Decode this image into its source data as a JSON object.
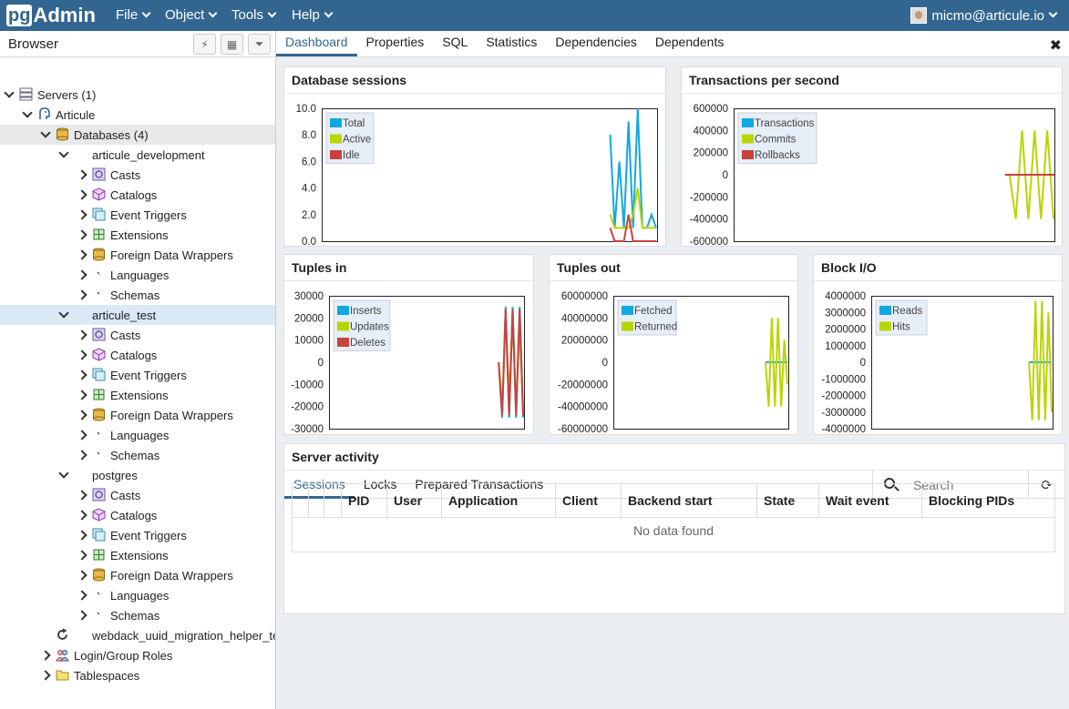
{
  "app": {
    "logo_pg": "pg",
    "logo_rest": "Admin"
  },
  "menu": {
    "file": "File",
    "object": "Object",
    "tools": "Tools",
    "help": "Help"
  },
  "user": {
    "email": "micmo@articule.io"
  },
  "browser": {
    "title": "Browser"
  },
  "tree": [
    {
      "label": "Servers (1)",
      "icon": "servers-icon"
    },
    {
      "label": "Articule",
      "icon": "elephant-icon"
    },
    {
      "label": "Databases (4)",
      "icon": "databases-icon"
    },
    {
      "label": "articule_development",
      "icon": "database-icon"
    },
    {
      "label": "Casts",
      "icon": "casts-icon"
    },
    {
      "label": "Catalogs",
      "icon": "catalogs-icon"
    },
    {
      "label": "Event Triggers",
      "icon": "event-triggers-icon"
    },
    {
      "label": "Extensions",
      "icon": "extensions-icon"
    },
    {
      "label": "Foreign Data Wrappers",
      "icon": "fdw-icon"
    },
    {
      "label": "Languages",
      "icon": "languages-icon"
    },
    {
      "label": "Schemas",
      "icon": "schemas-icon"
    },
    {
      "label": "articule_test",
      "icon": "database-icon"
    },
    {
      "label": "Casts",
      "icon": "casts-icon"
    },
    {
      "label": "Catalogs",
      "icon": "catalogs-icon"
    },
    {
      "label": "Event Triggers",
      "icon": "event-triggers-icon"
    },
    {
      "label": "Extensions",
      "icon": "extensions-icon"
    },
    {
      "label": "Foreign Data Wrappers",
      "icon": "fdw-icon"
    },
    {
      "label": "Languages",
      "icon": "languages-icon"
    },
    {
      "label": "Schemas",
      "icon": "schemas-icon"
    },
    {
      "label": "postgres",
      "icon": "database-icon"
    },
    {
      "label": "Casts",
      "icon": "casts-icon"
    },
    {
      "label": "Catalogs",
      "icon": "catalogs-icon"
    },
    {
      "label": "Event Triggers",
      "icon": "event-triggers-icon"
    },
    {
      "label": "Extensions",
      "icon": "extensions-icon"
    },
    {
      "label": "Foreign Data Wrappers",
      "icon": "fdw-icon"
    },
    {
      "label": "Languages",
      "icon": "languages-icon"
    },
    {
      "label": "Schemas",
      "icon": "schemas-icon"
    },
    {
      "label": "webdack_uuid_migration_helper_test",
      "icon": "spinner-icon"
    },
    {
      "label": "Login/Group Roles",
      "icon": "roles-icon"
    },
    {
      "label": "Tablespaces",
      "icon": "tablespaces-icon"
    }
  ],
  "tabs": [
    "Dashboard",
    "Properties",
    "SQL",
    "Statistics",
    "Dependencies",
    "Dependents"
  ],
  "colors": {
    "header": "#326690",
    "blue": "#12a8e0",
    "green": "#b9d500",
    "red": "#c8423f"
  },
  "panels": {
    "sessions_title": "Database sessions",
    "tps_title": "Transactions per second",
    "tuples_in_title": "Tuples in",
    "tuples_out_title": "Tuples out",
    "blockio_title": "Block I/O",
    "activity_title": "Server activity"
  },
  "chart_data": [
    {
      "type": "line",
      "title": "Database sessions",
      "ylim": [
        0,
        10
      ],
      "y_ticks": [
        "10.0",
        "8.0",
        "6.0",
        "4.0",
        "2.0",
        "0.0"
      ],
      "legend": "top-left",
      "series": [
        {
          "name": "Total",
          "color": "#12a8e0",
          "values": [
            8,
            1,
            6,
            1,
            9,
            1,
            10,
            1,
            1,
            2,
            1
          ]
        },
        {
          "name": "Active",
          "color": "#b9d500",
          "values": [
            2,
            1,
            1,
            1,
            1,
            2,
            4,
            1,
            1,
            1,
            1
          ]
        },
        {
          "name": "Idle",
          "color": "#c8423f",
          "values": [
            1,
            0,
            0,
            0,
            2,
            0,
            0,
            0,
            0,
            0,
            0
          ]
        }
      ]
    },
    {
      "type": "line",
      "title": "Transactions per second",
      "ylim": [
        -600000,
        600000
      ],
      "y_ticks": [
        "600000",
        "400000",
        "200000",
        "0",
        "-200000",
        "-400000",
        "-600000"
      ],
      "legend": "top-left",
      "series": [
        {
          "name": "Transactions",
          "color": "#12a8e0",
          "values": [
            0,
            0,
            0,
            0,
            0,
            0,
            0,
            0
          ]
        },
        {
          "name": "Commits",
          "color": "#b9d500",
          "values": [
            0,
            -400000,
            400000,
            -400000,
            400000,
            -400000,
            400000,
            -400000
          ]
        },
        {
          "name": "Rollbacks",
          "color": "#c8423f",
          "values": [
            0,
            0,
            0,
            0,
            0,
            0,
            0,
            0
          ]
        }
      ]
    },
    {
      "type": "line",
      "title": "Tuples in",
      "ylim": [
        -30000,
        30000
      ],
      "y_ticks": [
        "30000",
        "20000",
        "10000",
        "0",
        "-10000",
        "-20000",
        "-30000"
      ],
      "legend": "top-left",
      "series": [
        {
          "name": "Inserts",
          "color": "#12a8e0",
          "values": [
            0,
            -25000,
            25000,
            -25000,
            25000,
            -25000,
            25000,
            -25000
          ]
        },
        {
          "name": "Updates",
          "color": "#b9d500",
          "values": [
            0,
            -20000,
            20000,
            -15000,
            20000,
            -20000,
            15000,
            -20000
          ]
        },
        {
          "name": "Deletes",
          "color": "#c8423f",
          "values": [
            0,
            -24000,
            24000,
            -24000,
            24000,
            -24000,
            24000,
            -24000
          ]
        }
      ]
    },
    {
      "type": "line",
      "title": "Tuples out",
      "ylim": [
        -60000000,
        60000000
      ],
      "y_ticks": [
        "60000000",
        "40000000",
        "20000000",
        "0",
        "-20000000",
        "-40000000",
        "-60000000"
      ],
      "legend": "top-left",
      "series": [
        {
          "name": "Fetched",
          "color": "#12a8e0",
          "values": [
            0,
            0,
            0,
            0,
            0,
            0,
            0,
            0
          ]
        },
        {
          "name": "Returned",
          "color": "#b9d500",
          "values": [
            0,
            -40000000,
            40000000,
            -40000000,
            40000000,
            -40000000,
            20000000,
            -20000000
          ]
        }
      ]
    },
    {
      "type": "line",
      "title": "Block I/O",
      "ylim": [
        -4000000,
        4000000
      ],
      "y_ticks": [
        "4000000",
        "3000000",
        "2000000",
        "1000000",
        "0",
        "-1000000",
        "-2000000",
        "-3000000",
        "-4000000"
      ],
      "legend": "top-left",
      "series": [
        {
          "name": "Reads",
          "color": "#12a8e0",
          "values": [
            0,
            0,
            0,
            0,
            0,
            0,
            0,
            0
          ]
        },
        {
          "name": "Hits",
          "color": "#b9d500",
          "values": [
            0,
            -3500000,
            3700000,
            -3500000,
            3700000,
            -3500000,
            3000000,
            -3000000
          ]
        }
      ]
    }
  ],
  "activity": {
    "tabs": [
      "Sessions",
      "Locks",
      "Prepared Transactions"
    ],
    "search_placeholder": "Search",
    "columns": [
      "PID",
      "User",
      "Application",
      "Client",
      "Backend start",
      "State",
      "Wait event",
      "Blocking PIDs"
    ],
    "empty_text": "No data found"
  }
}
